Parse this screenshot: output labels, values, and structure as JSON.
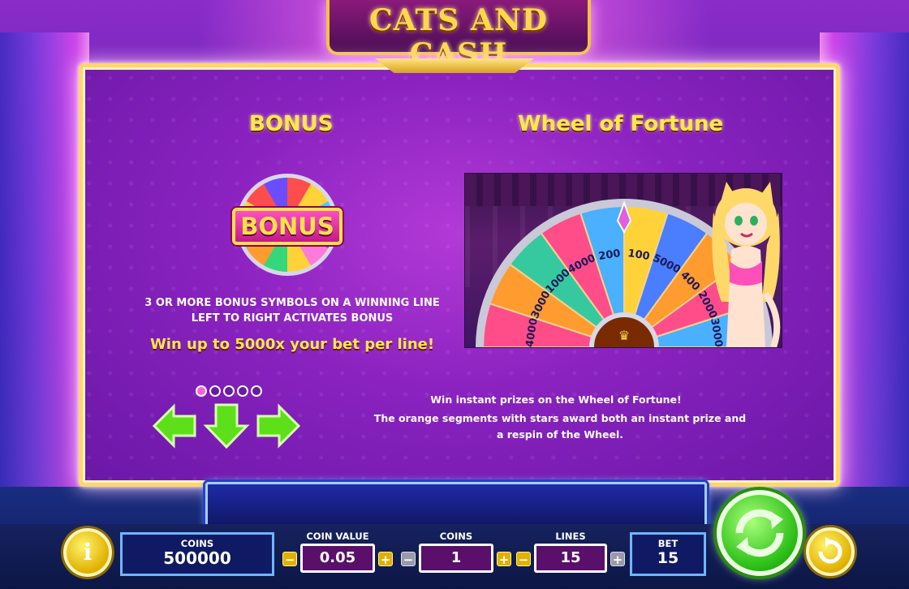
{
  "game": {
    "logo_text": "CATS AND CASH"
  },
  "paytable": {
    "bonus_heading": "BONUS",
    "bonus_symbol_text": "BONUS",
    "bonus_description": "3 OR MORE BONUS SYMBOLS ON A WINNING LINE LEFT TO RIGHT ACTIVATES BONUS",
    "bonus_win": "Win up to 5000x your bet per line!",
    "wheel_heading": "Wheel of Fortune",
    "wheel_line1": "Win instant prizes on the Wheel of Fortune!",
    "wheel_line2": "The orange segments with stars award both an instant prize and a respin of the Wheel.",
    "wheel_segments": [
      "4000",
      "3000",
      "1000",
      "4000",
      "200",
      "100",
      "5000",
      "400",
      "2000",
      "3000"
    ],
    "page_indicator": {
      "total": 5,
      "current": 1
    }
  },
  "controls": {
    "coins_label": "COINS",
    "coins_value": "500000",
    "coin_value_label": "COIN VALUE",
    "coin_value": "0.05",
    "coins_per_line_label": "COINS",
    "coins_per_line": "1",
    "lines_label": "LINES",
    "lines_value": "15",
    "bet_label": "BET",
    "bet_value": "15",
    "minus_symbol": "−",
    "plus_symbol": "+",
    "info_symbol": "i"
  },
  "colors": {
    "heading": "#ffe650",
    "panel": "#8a22c0",
    "border_gold": "#ffd66a",
    "spin_green": "#2fc11a"
  }
}
